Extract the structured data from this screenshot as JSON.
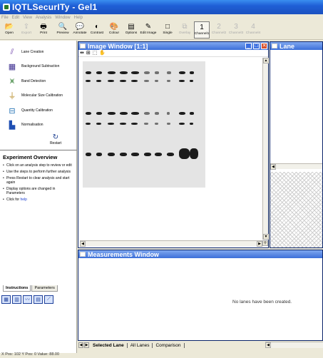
{
  "app": {
    "title": "IQTLSecurITy - Gel1"
  },
  "menu": [
    "File",
    "Edit",
    "View",
    "Analysis",
    "Window",
    "Help"
  ],
  "toolbar": [
    {
      "label": "Open",
      "icon": "folder-icon",
      "glyph": "📂",
      "state": "enabled"
    },
    {
      "label": "Export",
      "icon": "export-icon",
      "glyph": "⇪",
      "state": "disabled"
    },
    {
      "label": "Print",
      "icon": "printer-icon",
      "glyph": "🖶",
      "state": "enabled"
    },
    {
      "label": "Preview",
      "icon": "print-preview-icon",
      "glyph": "🔍",
      "state": "enabled"
    },
    {
      "label": "Annotate",
      "icon": "annotate-balloon-icon",
      "glyph": "💬",
      "state": "enabled"
    },
    {
      "label": "Contrast",
      "icon": "contrast-icon",
      "glyph": "◐",
      "state": "enabled"
    },
    {
      "label": "Colour",
      "icon": "colour-palette-icon",
      "glyph": "🎨",
      "state": "enabled"
    },
    {
      "label": "Options",
      "icon": "options-icon",
      "glyph": "▤",
      "state": "enabled"
    },
    {
      "label": "Edit Image",
      "icon": "edit-image-icon",
      "glyph": "✎",
      "state": "enabled"
    },
    {
      "label": "Single",
      "icon": "single-view-icon",
      "glyph": "□",
      "state": "enabled"
    },
    {
      "label": "Overlay",
      "icon": "overlay-icon",
      "glyph": "⧉",
      "state": "disabled"
    },
    {
      "label": "Channel1",
      "icon": "channel1-icon",
      "glyph": "1",
      "state": "selected"
    },
    {
      "label": "Channel2",
      "icon": "channel2-icon",
      "glyph": "2",
      "state": "disabled"
    },
    {
      "label": "Channel3",
      "icon": "channel3-icon",
      "glyph": "3",
      "state": "disabled"
    },
    {
      "label": "Channel4",
      "icon": "channel4-icon",
      "glyph": "4",
      "state": "disabled"
    }
  ],
  "steps": [
    {
      "label": "Lane Creation",
      "icon": "lane-creation-icon",
      "glyph": "⫽",
      "color": "#7a4fb0"
    },
    {
      "label": "Background Subtraction",
      "icon": "background-subtraction-icon",
      "glyph": "▦",
      "color": "#3b2c8f"
    },
    {
      "label": "Band Detection",
      "icon": "band-detection-icon",
      "glyph": "⩙",
      "color": "#2f7d2f"
    },
    {
      "label": "Molecular Size Calibration",
      "icon": "molecular-size-icon",
      "glyph": "⏚",
      "color": "#b3861a"
    },
    {
      "label": "Quantity Calibration",
      "icon": "quantity-calibration-icon",
      "glyph": "⊟",
      "color": "#1f6fb3"
    },
    {
      "label": "Normalisation",
      "icon": "normalisation-icon",
      "glyph": "▙",
      "color": "#1f4fb3"
    }
  ],
  "restart": {
    "label": "Restart",
    "glyph": "↻"
  },
  "overview": {
    "title": "Experiment Overview",
    "items": [
      "Click on an analysis step to review or edit",
      "Use the steps to perform further analysis",
      "Press Restart to clear analysis and start again",
      "Display options are changed in Parameters"
    ],
    "help_prefix": "Click for ",
    "help_link": "help"
  },
  "left_tabs": {
    "instructions": "Instructions",
    "parameters": "Parameters"
  },
  "image_window": {
    "title": "Image Window [1:1]"
  },
  "lane_window": {
    "title": "Lane"
  },
  "measurements": {
    "title": "Measurements Window",
    "message": "No lanes have been created."
  },
  "bottom_tabs": [
    "Selected Lane",
    "All Lanes",
    "Comparison"
  ],
  "status": "X Pos: 102  Y Pos: 0  Value: 88.00",
  "colors": {
    "title_blue": "#1f5fd6",
    "pane_head": "#3c6fd8",
    "close_red": "#d9502a"
  }
}
